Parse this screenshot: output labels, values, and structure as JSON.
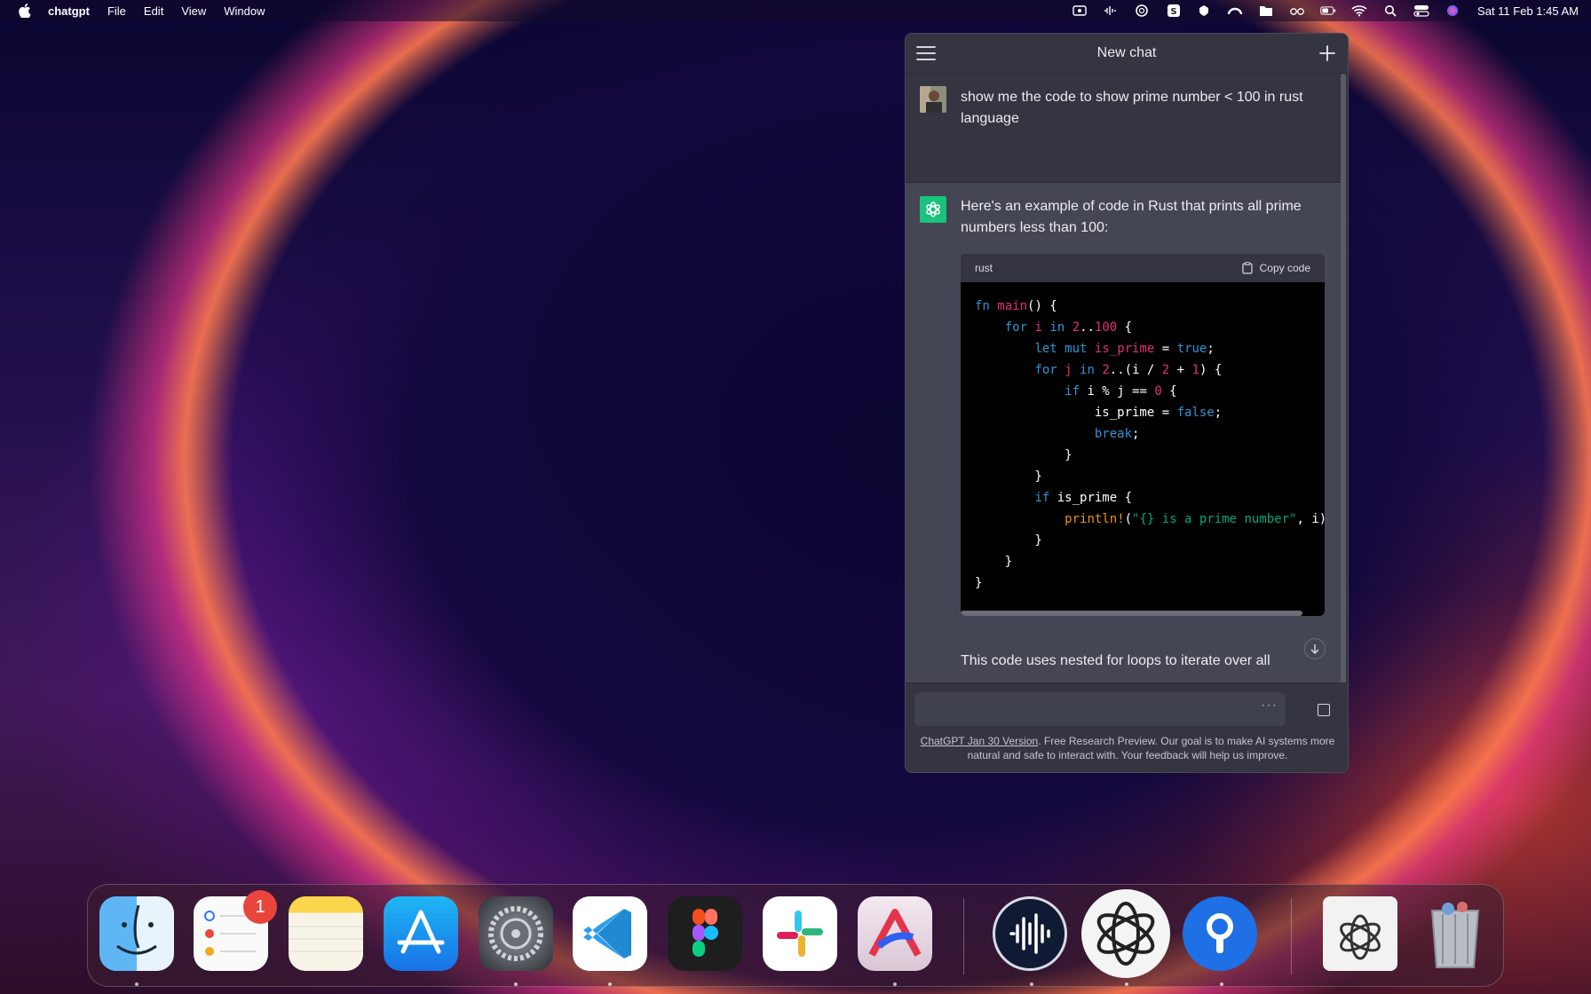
{
  "menubar": {
    "apple_icon": "apple-logo-icon",
    "app_name": "chatgpt",
    "items": [
      "File",
      "Edit",
      "View",
      "Window"
    ],
    "clock": "Sat 11 Feb  1:45 AM",
    "status_icons": [
      "screen-record-icon",
      "audio-wave-icon",
      "chatgpt-icon",
      "s-app-icon",
      "vpn-icon",
      "cloud-icon",
      "folder-icon",
      "glasses-icon",
      "battery-icon",
      "wifi-icon",
      "spotlight-search-icon",
      "control-center-icon",
      "siri-icon"
    ]
  },
  "chat": {
    "title": "New chat",
    "user_message": "show me the code to show prime number < 100 in rust language",
    "assistant_intro": "Here's an example of code in Rust that prints all prime numbers less than 100:",
    "code_language": "rust",
    "copy_label": "Copy code",
    "assistant_after": "This code uses nested for loops to iterate over all",
    "input_placeholder": "",
    "input_dots": "···",
    "footer_link": "ChatGPT Jan 30 Version",
    "footer_text": ". Free Research Preview. Our goal is to make AI systems more natural and safe to interact with. Your feedback will help us improve."
  },
  "dock": {
    "apps": [
      "Finder",
      "Reminders",
      "Notes",
      "App Store",
      "System Settings",
      "Visual Studio Code",
      "Figma",
      "Slack",
      "Affinity Designer",
      "Podcast app",
      "ChatGPT",
      "Proton VPN",
      "ChatGPT document",
      "Trash"
    ],
    "reminders_badge": "1"
  },
  "colors": {
    "chat_bg": "#343541",
    "assistant_bg": "#444654",
    "gpt_green": "#19c37d",
    "keyword": "#2e95d3",
    "number": "#df3079",
    "string": "#00a67d",
    "macro": "#e9950c"
  }
}
